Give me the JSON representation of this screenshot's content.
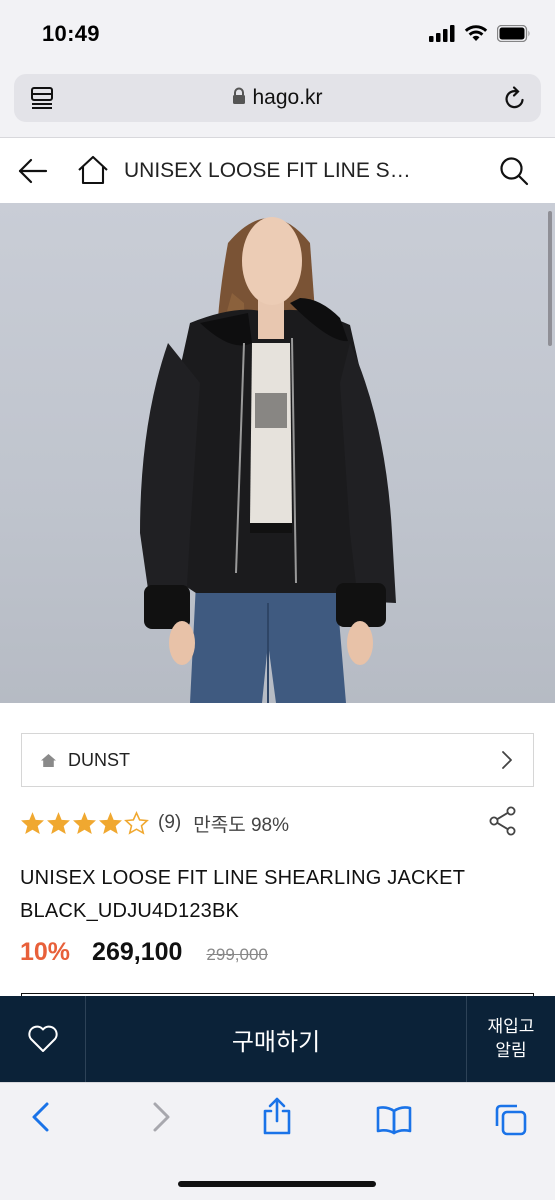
{
  "status_bar": {
    "time": "10:49",
    "icons": [
      "cellular-signal-icon",
      "wifi-icon",
      "battery-icon"
    ]
  },
  "browser": {
    "url": "hago.kr",
    "icons": [
      "reader-mode-icon",
      "lock-icon",
      "reload-icon"
    ]
  },
  "header": {
    "title": "UNISEX LOOSE FIT LINE S…",
    "icons": [
      "back-arrow-icon",
      "home-icon",
      "search-icon"
    ]
  },
  "product": {
    "brand": "DUNST",
    "rating": {
      "stars": 4.5,
      "max_stars": 5,
      "review_count": "(9)",
      "satisfaction": "만족도 98%"
    },
    "title": "UNISEX LOOSE FIT LINE SHEARLING JACKET BLACK_UDJU4D123BK",
    "discount": "10%",
    "price": "269,100",
    "original_price": "299,000"
  },
  "buy_bar": {
    "buy_label": "구매하기",
    "restock_line1": "재입고",
    "restock_line2": "알림"
  },
  "toolbar": {
    "icons": [
      "back-icon",
      "forward-icon",
      "share-icon",
      "bookmarks-icon",
      "tabs-icon"
    ]
  },
  "colors": {
    "accent_discount": "#e8603a",
    "star": "#f0a830",
    "buy_bar": "#0b2238",
    "link_blue": "#1a73e8"
  }
}
